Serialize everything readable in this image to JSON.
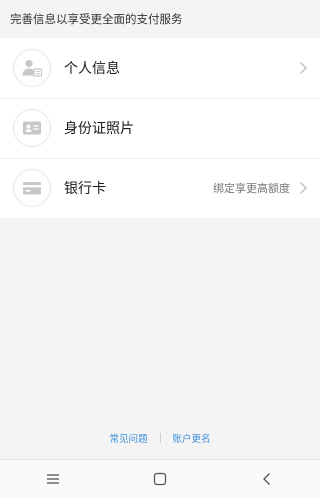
{
  "header": {
    "note": "完善信息以享受更全面的支付服务"
  },
  "items": [
    {
      "label": "个人信息",
      "sub": "",
      "icon": "person-card-icon",
      "has_arrow": true
    },
    {
      "label": "身份证照片",
      "sub": "",
      "icon": "id-card-icon",
      "has_arrow": false
    },
    {
      "label": "银行卡",
      "sub": "绑定享更高额度",
      "icon": "bank-card-icon",
      "has_arrow": true
    }
  ],
  "footer": {
    "faq_label": "常见问题",
    "rename_label": "账户更名"
  },
  "nav": {
    "menu_icon": "menu-icon",
    "home_icon": "home-icon",
    "back_icon": "back-icon"
  },
  "colors": {
    "link": "#3d8fd8",
    "background": "#f4f4f4",
    "icon_gray": "#c8c8c8"
  }
}
